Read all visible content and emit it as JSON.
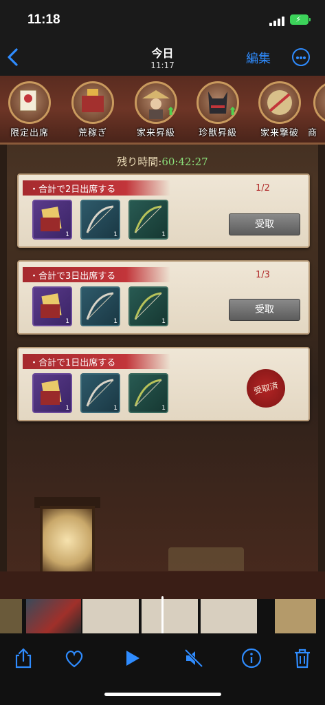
{
  "status_bar": {
    "time": "11:18"
  },
  "nav": {
    "title": "今日",
    "subtitle": "11:17",
    "edit_label": "編集"
  },
  "game": {
    "tabs": [
      {
        "label": "限定出席",
        "has_up_arrow": false
      },
      {
        "label": "荒稼ぎ",
        "has_up_arrow": false
      },
      {
        "label": "家来昇級",
        "has_up_arrow": true
      },
      {
        "label": "珍獣昇級",
        "has_up_arrow": true
      },
      {
        "label": "家来撃破",
        "has_up_arrow": false
      },
      {
        "label": "商",
        "has_up_arrow": false
      }
    ],
    "timer_label": "残り時間:",
    "timer_value": "60:42:27",
    "cards": [
      {
        "title": "合計で2日出席する",
        "progress": "1/2",
        "button": "受取",
        "claimed": false,
        "rewards": [
          {
            "kind": "scroll",
            "count": "1"
          },
          {
            "kind": "bow",
            "count": "1"
          },
          {
            "kind": "bow",
            "count": "1"
          }
        ]
      },
      {
        "title": "合計で3日出席する",
        "progress": "1/3",
        "button": "受取",
        "claimed": false,
        "rewards": [
          {
            "kind": "scroll",
            "count": "1"
          },
          {
            "kind": "bow",
            "count": "1"
          },
          {
            "kind": "bow",
            "count": "1"
          }
        ]
      },
      {
        "title": "合計で1日出席する",
        "progress": "",
        "button": "",
        "claimed": true,
        "stamp": "受取済",
        "rewards": [
          {
            "kind": "scroll",
            "count": "1"
          },
          {
            "kind": "bow",
            "count": "1"
          },
          {
            "kind": "bow",
            "count": "1"
          }
        ]
      }
    ]
  },
  "toolbar": {
    "icons": [
      "share-icon",
      "heart-icon",
      "play-icon",
      "mute-icon",
      "info-icon",
      "trash-icon"
    ]
  },
  "colors": {
    "accent": "#2f8cff",
    "ribbon": "#c2353a",
    "timer_value": "#8be07a",
    "battery": "#3cd35a"
  }
}
